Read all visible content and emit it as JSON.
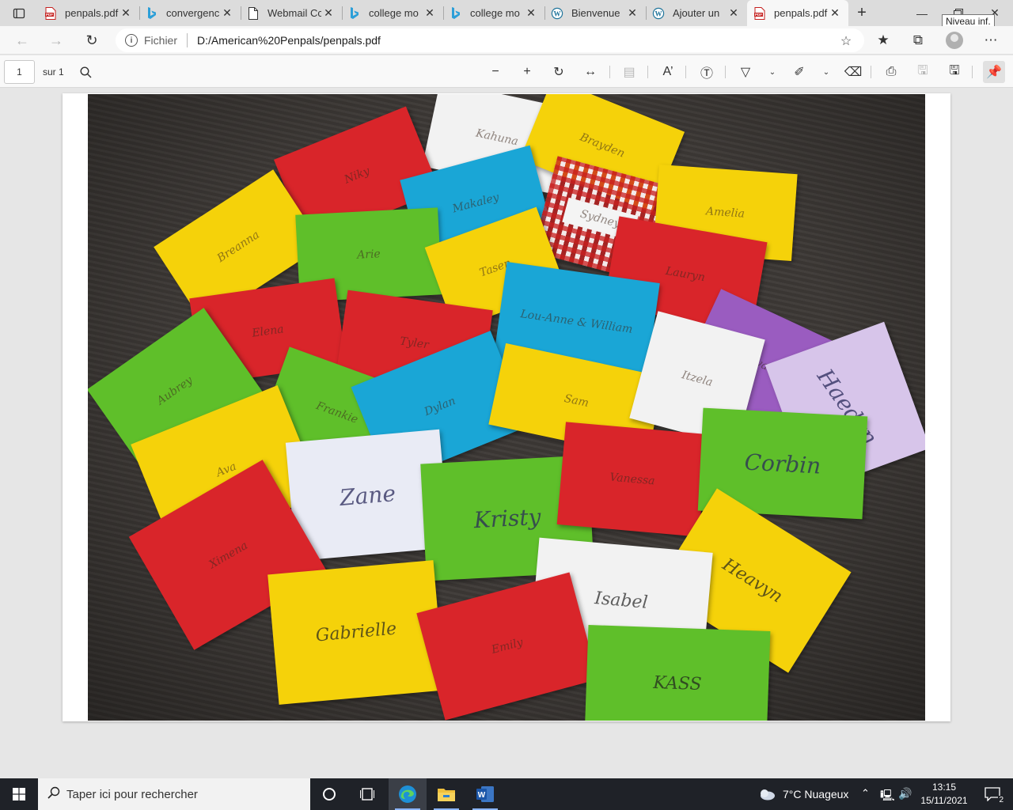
{
  "browser": {
    "tabs": [
      {
        "title": "penpals.pdf",
        "icon": "pdf-icon",
        "active": false
      },
      {
        "title": "convergenc",
        "icon": "bing-icon",
        "active": false
      },
      {
        "title": "Webmail Cc",
        "icon": "page-icon",
        "active": false
      },
      {
        "title": "college mo",
        "icon": "bing-icon",
        "active": false
      },
      {
        "title": "college mo",
        "icon": "bing-icon",
        "active": false
      },
      {
        "title": "Bienvenue",
        "icon": "wordpress-icon",
        "active": false
      },
      {
        "title": "Ajouter un",
        "icon": "wordpress-icon",
        "active": false
      },
      {
        "title": "penpals.pdf",
        "icon": "pdf-icon",
        "active": true
      }
    ],
    "tooltip": "Niveau inf.",
    "address": {
      "scheme": "Fichier",
      "url": "D:/American%20Penpals/penpals.pdf"
    }
  },
  "pdf_toolbar": {
    "page_number": "1",
    "page_total": "sur 1"
  },
  "photo": {
    "envelopes": [
      {
        "name": "Kahuna",
        "color": "#f2f2f2"
      },
      {
        "name": "Brayden",
        "color": "#f5d20a"
      },
      {
        "name": "Niky",
        "color": "#d9252a"
      },
      {
        "name": "Makaley",
        "color": "#1aa6d6"
      },
      {
        "name": "Sydney",
        "color": "checkered"
      },
      {
        "name": "Amelia",
        "color": "#f5d20a"
      },
      {
        "name": "Breanna",
        "color": "#f5d20a"
      },
      {
        "name": "Arie",
        "color": "#5fbf2a"
      },
      {
        "name": "Tasen",
        "color": "#f5d20a"
      },
      {
        "name": "Lauryn",
        "color": "#d9252a"
      },
      {
        "name": "Elena",
        "color": "#d9252a"
      },
      {
        "name": "Tyler",
        "color": "#d9252a"
      },
      {
        "name": "Lou-Anne & William",
        "color": "#1aa6d6"
      },
      {
        "name": "Ava",
        "color": "#9a5cc0"
      },
      {
        "name": "Aubrey",
        "color": "#5fbf2a"
      },
      {
        "name": "Frankie",
        "color": "#5fbf2a"
      },
      {
        "name": "Dylan",
        "color": "#1aa6d6"
      },
      {
        "name": "Sam",
        "color": "#f5d20a"
      },
      {
        "name": "Itzela",
        "color": "#f2f2f2"
      },
      {
        "name": "Haedyn",
        "color": "#d7c5ea"
      },
      {
        "name": "Ava",
        "color": "#f5d20a"
      },
      {
        "name": "Zane",
        "color": "#e9ebf5"
      },
      {
        "name": "Kristy",
        "color": "#5fbf2a"
      },
      {
        "name": "Vanessa",
        "color": "#d9252a"
      },
      {
        "name": "Corbin",
        "color": "#5fbf2a"
      },
      {
        "name": "Ximena",
        "color": "#d9252a"
      },
      {
        "name": "Heavyn",
        "color": "#f5d20a"
      },
      {
        "name": "Isabel",
        "color": "#f2f2f2"
      },
      {
        "name": "Gabrielle",
        "color": "#f5d20a"
      },
      {
        "name": "Emily",
        "color": "#d9252a"
      },
      {
        "name": "KASS",
        "color": "#5fbf2a"
      }
    ]
  },
  "taskbar": {
    "search_placeholder": "Taper ici pour rechercher",
    "weather": "7°C  Nuageux",
    "time": "13:15",
    "date": "15/11/2021",
    "notifications": "2"
  },
  "colors": {
    "accent": "#0078d4",
    "pdf_red": "#c5201f",
    "taskbar": "#1f2228"
  }
}
